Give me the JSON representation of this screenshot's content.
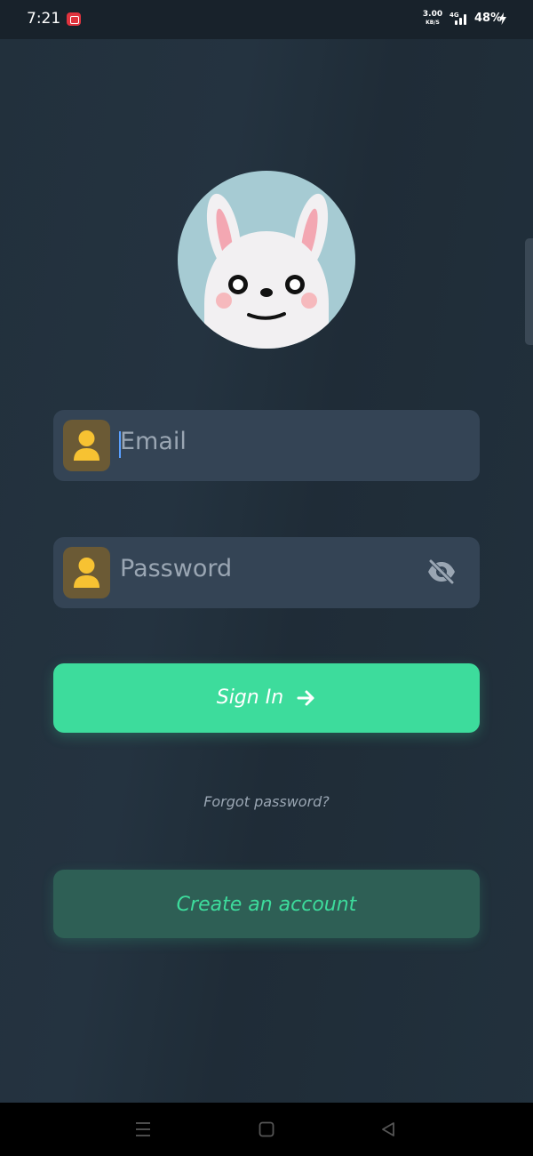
{
  "status_bar": {
    "time": "7:21",
    "net_speed": "3.00",
    "net_unit": "KB/S",
    "network_type": "4G",
    "battery": "48%"
  },
  "avatar": {
    "icon": "bunny-avatar"
  },
  "login_form": {
    "email_placeholder": "Email",
    "password_placeholder": "Password"
  },
  "buttons": {
    "sign_in": "Sign In",
    "forgot_password": "Forgot password?",
    "create_account": "Create an account"
  },
  "colors": {
    "background": "#1f2c38",
    "field_bg": "#344455",
    "accent": "#3ddc9c",
    "icon_box": "#6b5a35",
    "icon_yellow": "#f7c232",
    "avatar_bg": "#a6cbd3"
  },
  "nav_bar": {
    "icons": [
      "menu-icon",
      "home-icon",
      "back-icon"
    ]
  }
}
